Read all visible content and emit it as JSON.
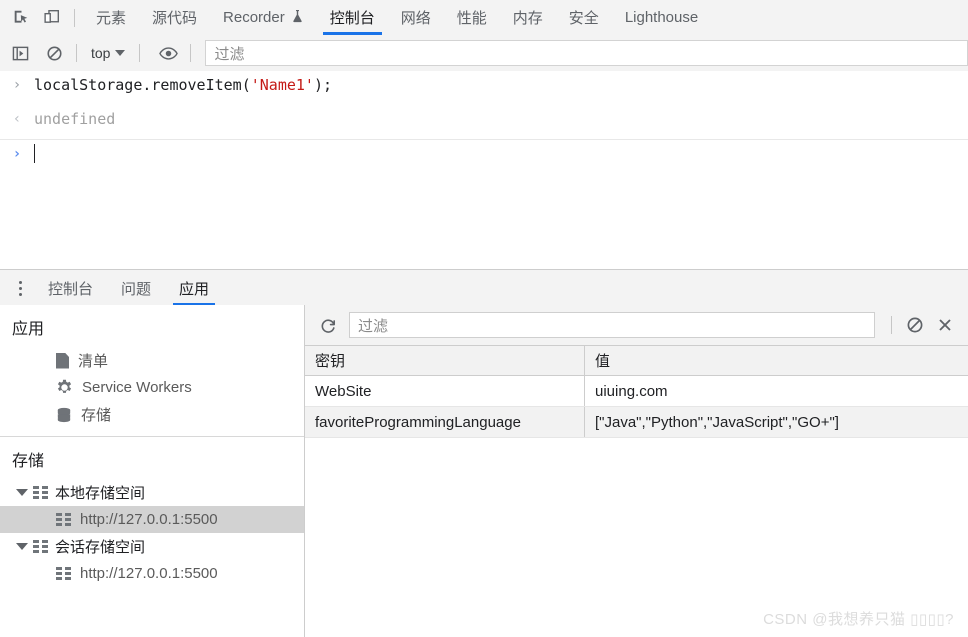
{
  "devtools": {
    "top_tabs": [
      {
        "label": "元素",
        "selected": false
      },
      {
        "label": "源代码",
        "selected": false
      },
      {
        "label": "Recorder",
        "selected": false,
        "icon": "flask-icon"
      },
      {
        "label": "控制台",
        "selected": true
      },
      {
        "label": "网络",
        "selected": false
      },
      {
        "label": "性能",
        "selected": false
      },
      {
        "label": "内存",
        "selected": false
      },
      {
        "label": "安全",
        "selected": false
      },
      {
        "label": "Lighthouse",
        "selected": false
      }
    ],
    "top_icons": [
      "inspect-element-icon",
      "device-toolbar-icon"
    ]
  },
  "console_toolbar": {
    "sidebar_toggle_icon": "console-sidebar-icon",
    "clear_icon": "clear-console-icon",
    "context_value": "top",
    "eye_icon": "live-expression-icon",
    "filter_placeholder": "过滤"
  },
  "console": {
    "entries": [
      {
        "type": "input",
        "gutter": "›",
        "code_prefix": "localStorage.removeItem(",
        "code_string": "'Name1'",
        "code_suffix": ");"
      },
      {
        "type": "result",
        "gutter": "‹",
        "text": "undefined"
      }
    ],
    "prompt_gutter": "›",
    "prompt_value": ""
  },
  "drawer": {
    "menu_icon": "more-options-icon",
    "tabs": [
      {
        "label": "控制台",
        "selected": false
      },
      {
        "label": "问题",
        "selected": false
      },
      {
        "label": "应用",
        "selected": true
      }
    ]
  },
  "application": {
    "sections": [
      {
        "title": "应用",
        "items": [
          {
            "label": "清单",
            "icon": "manifest-doc-icon",
            "selected": false,
            "indent": "child",
            "expandable": false
          },
          {
            "label": "Service Workers",
            "icon": "gear-icon",
            "selected": false,
            "indent": "child",
            "expandable": false
          },
          {
            "label": "存储",
            "icon": "database-icon",
            "selected": false,
            "indent": "child",
            "expandable": false
          }
        ]
      },
      {
        "title": "存储",
        "items": [
          {
            "label": "本地存储空间",
            "icon": "grid-icon",
            "selected": false,
            "indent": "root",
            "expandable": true
          },
          {
            "label": "http://127.0.0.1:5500",
            "icon": "grid-icon",
            "selected": true,
            "indent": "child",
            "expandable": false
          },
          {
            "label": "会话存储空间",
            "icon": "grid-icon",
            "selected": false,
            "indent": "root",
            "expandable": true
          },
          {
            "label": "http://127.0.0.1:5500",
            "icon": "grid-icon",
            "selected": false,
            "indent": "child",
            "expandable": false
          }
        ]
      }
    ]
  },
  "storage_panel": {
    "refresh_icon": "refresh-icon",
    "filter_placeholder": "过滤",
    "clear_all_icon": "clear-all-icon",
    "delete_selected_icon": "delete-selected-icon",
    "table": {
      "columns": [
        "密钥",
        "值"
      ],
      "rows": [
        {
          "key": "WebSite",
          "value": "uiuing.com"
        },
        {
          "key": "favoriteProgrammingLanguage",
          "value": "[\"Java\",\"Python\",\"JavaScript\",\"GO+\"]"
        }
      ]
    }
  },
  "watermark": {
    "text": "CSDN @我想养只猫 ▯▯▯▯?"
  },
  "colors": {
    "accent": "#1a73e8",
    "toolbar_bg": "#f3f3f3",
    "selected_row": "#d2d2d2",
    "string_token": "#c41a16",
    "muted_text": "#9aa0a6"
  }
}
